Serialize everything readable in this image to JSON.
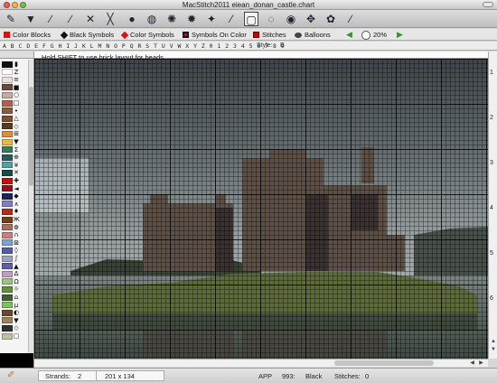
{
  "window": {
    "title": "MacStitch2011  eiean_donan_castle.chart"
  },
  "toolbar": {
    "tools": [
      {
        "name": "pencil-tool-icon",
        "glyph": "✎"
      },
      {
        "name": "paint-bucket-icon",
        "glyph": "▼"
      },
      {
        "name": "line-tool-icon",
        "glyph": "∕"
      },
      {
        "name": "backstitch-tool-icon",
        "glyph": "∕"
      },
      {
        "name": "eraser-tool-icon",
        "glyph": "✕"
      },
      {
        "name": "select-tool-icon",
        "glyph": "╳"
      },
      {
        "name": "bead-tool-icon",
        "glyph": "●"
      },
      {
        "name": "pattern-fill-icon",
        "glyph": "◍"
      },
      {
        "name": "knot-tool-icon",
        "glyph": "✺"
      },
      {
        "name": "french-knot-icon",
        "glyph": "✹"
      },
      {
        "name": "special-stitch-icon",
        "glyph": "✦"
      },
      {
        "name": "wand-tool-icon",
        "glyph": "⁄"
      },
      {
        "name": "rect-select-icon",
        "glyph": "▢"
      },
      {
        "name": "lasso-tool-icon",
        "glyph": "◌"
      },
      {
        "name": "zoom-tool-icon",
        "glyph": "◉"
      },
      {
        "name": "hand-tool-icon",
        "glyph": "✥"
      },
      {
        "name": "rotate-tool-icon",
        "glyph": "✿"
      },
      {
        "name": "eyedropper-icon",
        "glyph": "⁄"
      }
    ]
  },
  "symbar": {
    "color_blocks": "Color Blocks",
    "black_symbols": "Black Symbols",
    "color_symbols": "Color Symbols",
    "symbols_on_color": "Symbols On Color",
    "stitches": "Stitches",
    "balloons": "Balloons",
    "zoom": "20%",
    "colors": {
      "red": "#dd1111",
      "green": "#2a9b2a"
    }
  },
  "alphabar": {
    "chars": "A B C D E F G H I J K L M N O P Q R S T U V W X Y Z 0 1 2 3 4 5 6 7 8 9",
    "style_label": "Style:",
    "style_value": "B"
  },
  "canvas": {
    "hint": "Hold SHIFT to use brick layout for beads",
    "ruler_numbers": [
      "1",
      "2",
      "3",
      "4",
      "5",
      "6"
    ]
  },
  "palette": {
    "rows": [
      {
        "color": "#111111",
        "sym": "▮"
      },
      {
        "color": "#ffffff",
        "sym": "Z"
      },
      {
        "color": "#e8e2d8",
        "sym": "≡"
      },
      {
        "color": "#6a4a3a",
        "sym": "■"
      },
      {
        "color": "#c9a9a0",
        "sym": "○"
      },
      {
        "color": "#b06050",
        "sym": "□"
      },
      {
        "color": "#8a5a40",
        "sym": "•"
      },
      {
        "color": "#7a5030",
        "sym": "△"
      },
      {
        "color": "#5b3a22",
        "sym": "◇"
      },
      {
        "color": "#d89040",
        "sym": "⊞"
      },
      {
        "color": "#e8b840",
        "sym": "▼"
      },
      {
        "color": "#3a7a5a",
        "sym": "Σ"
      },
      {
        "color": "#2a5a5a",
        "sym": "⊕"
      },
      {
        "color": "#5aa0a0",
        "sym": "¥"
      },
      {
        "color": "#184a4a",
        "sym": "✕"
      },
      {
        "color": "#c01010",
        "sym": "✚"
      },
      {
        "color": "#901020",
        "sym": "◄"
      },
      {
        "color": "#202060",
        "sym": "◆"
      },
      {
        "color": "#8080c0",
        "sym": "∧"
      },
      {
        "color": "#b03020",
        "sym": "♦"
      },
      {
        "color": "#704020",
        "sym": "Ж"
      },
      {
        "color": "#a07060",
        "sym": "Φ"
      },
      {
        "color": "#c88080",
        "sym": "∩"
      },
      {
        "color": "#80a0d0",
        "sym": "⊠"
      },
      {
        "color": "#5060a0",
        "sym": "◊"
      },
      {
        "color": "#a0a0c0",
        "sym": "∫"
      },
      {
        "color": "#6060a0",
        "sym": "▲"
      },
      {
        "color": "#c0a0c0",
        "sym": "∆"
      },
      {
        "color": "#a0c080",
        "sym": "Ω"
      },
      {
        "color": "#609040",
        "sym": "☼"
      },
      {
        "color": "#406030",
        "sym": "⌂"
      },
      {
        "color": "#80c060",
        "sym": "µ"
      },
      {
        "color": "#6a4a2a",
        "sym": "◐"
      },
      {
        "color": "#a08060",
        "sym": "▼"
      },
      {
        "color": "#303030",
        "sym": "◇"
      },
      {
        "color": "#c0c0a0",
        "sym": "▢"
      }
    ]
  },
  "status": {
    "strands_label": "Strands:",
    "strands_value": "2",
    "size": "201 x 134",
    "brand": "APP",
    "color_code": "993:",
    "color_name": "Black",
    "stitches_label": "Stitches:",
    "stitches_value": "0"
  }
}
